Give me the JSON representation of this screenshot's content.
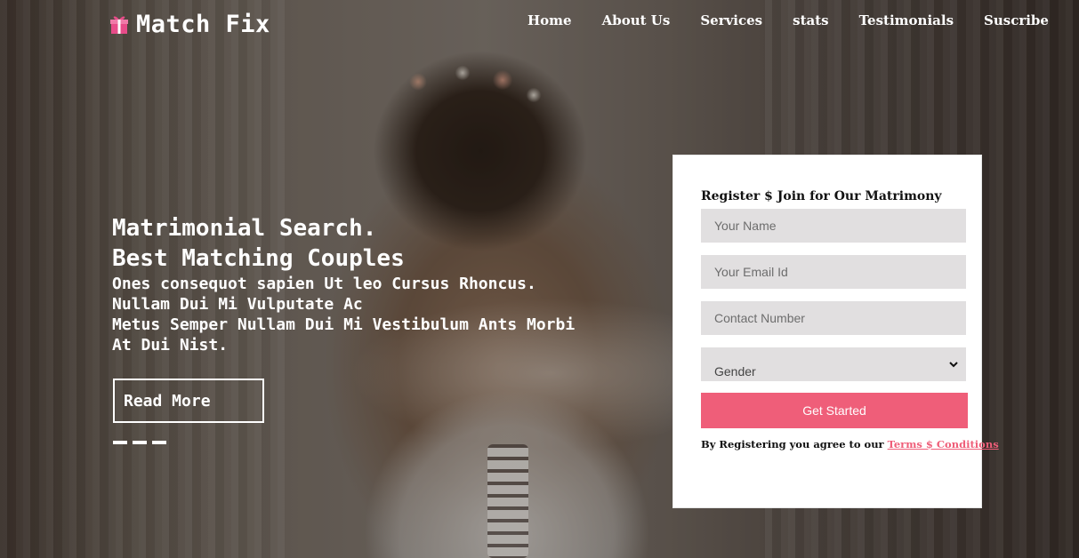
{
  "brand": {
    "name": "Match Fix",
    "icon": "gift-icon",
    "icon_color": "#e84c89"
  },
  "nav": {
    "items": [
      {
        "label": "Home"
      },
      {
        "label": "About Us"
      },
      {
        "label": "Services"
      },
      {
        "label": "stats"
      },
      {
        "label": "Testimonials"
      },
      {
        "label": "Suscribe"
      }
    ]
  },
  "hero": {
    "headline_1": "Matrimonial Search.",
    "headline_2": "Best Matching Couples",
    "sub_1": "Ones consequot sapien Ut leo Cursus Rhoncus.",
    "sub_2": "Nullam Dui Mi Vulputate Ac",
    "sub_3": "Metus Semper Nullam Dui Mi Vestibulum Ants Morbi",
    "sub_4": "At Dui Nist.",
    "read_more": "Read More",
    "slide_count": 3,
    "active_slide": 1
  },
  "register": {
    "title": "Register $ Join for Our Matrimony",
    "name_placeholder": "Your Name",
    "email_placeholder": "Your Email Id",
    "phone_placeholder": "Contact Number",
    "gender_value": "Gender",
    "submit": "Get Started",
    "terms_prefix": "By Registering you agree to our ",
    "terms_link": "Terms $ Conditions"
  },
  "colors": {
    "accent": "#ef5e79",
    "field_bg": "#e1dfe0",
    "text_light": "#ffffff"
  }
}
